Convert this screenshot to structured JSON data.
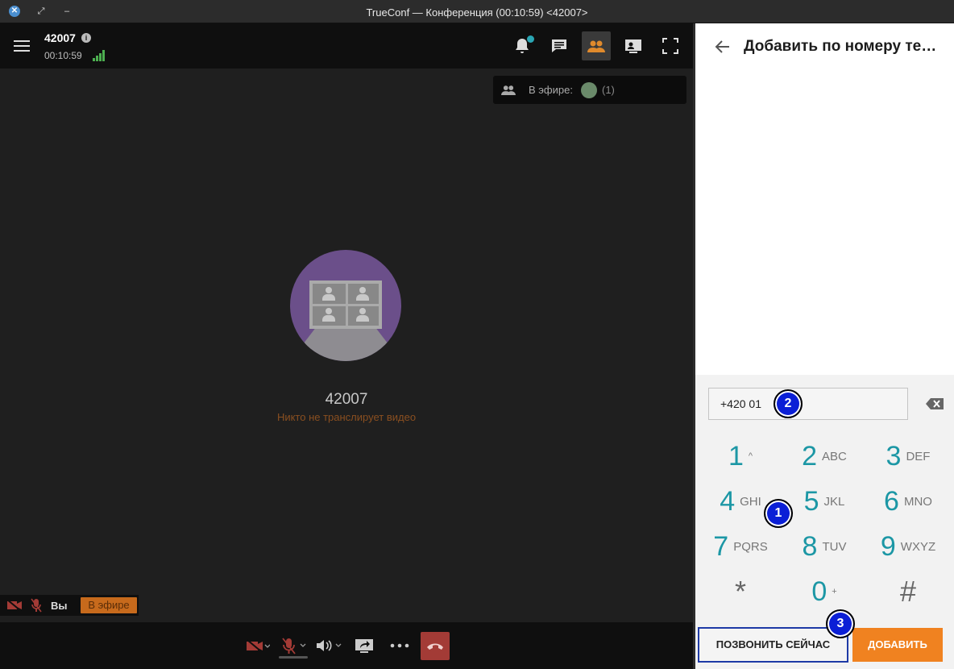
{
  "window": {
    "title": "TrueConf — Конференция (00:10:59) <42007>"
  },
  "conference": {
    "id": "42007",
    "timer": "00:10:59",
    "on_air_label": "В эфире:",
    "on_air_count": "(1)",
    "center_name": "42007",
    "no_video_message": "Никто не транслирует видео",
    "self_label": "Вы",
    "self_badge": "В эфире"
  },
  "panel": {
    "title": "Добавить по номеру телефона",
    "phone_value": "+420 01",
    "keys": [
      {
        "digit": "1",
        "letters": "^"
      },
      {
        "digit": "2",
        "letters": "ABC"
      },
      {
        "digit": "3",
        "letters": "DEF"
      },
      {
        "digit": "4",
        "letters": "GHI"
      },
      {
        "digit": "5",
        "letters": "JKL"
      },
      {
        "digit": "6",
        "letters": "MNO"
      },
      {
        "digit": "7",
        "letters": "PQRS"
      },
      {
        "digit": "8",
        "letters": "TUV"
      },
      {
        "digit": "9",
        "letters": "WXYZ"
      },
      {
        "digit": "*",
        "letters": ""
      },
      {
        "digit": "0",
        "letters": "+"
      },
      {
        "digit": "#",
        "letters": ""
      }
    ],
    "call_now_label": "ПОЗВОНИТЬ СЕЙЧАС",
    "add_label": "ДОБАВИТЬ"
  },
  "markers": [
    "1",
    "2",
    "3"
  ],
  "colors": {
    "accent": "#1c97a5",
    "orange": "#f08220",
    "hangup": "#a33b36",
    "marker": "#0b1fd6"
  }
}
